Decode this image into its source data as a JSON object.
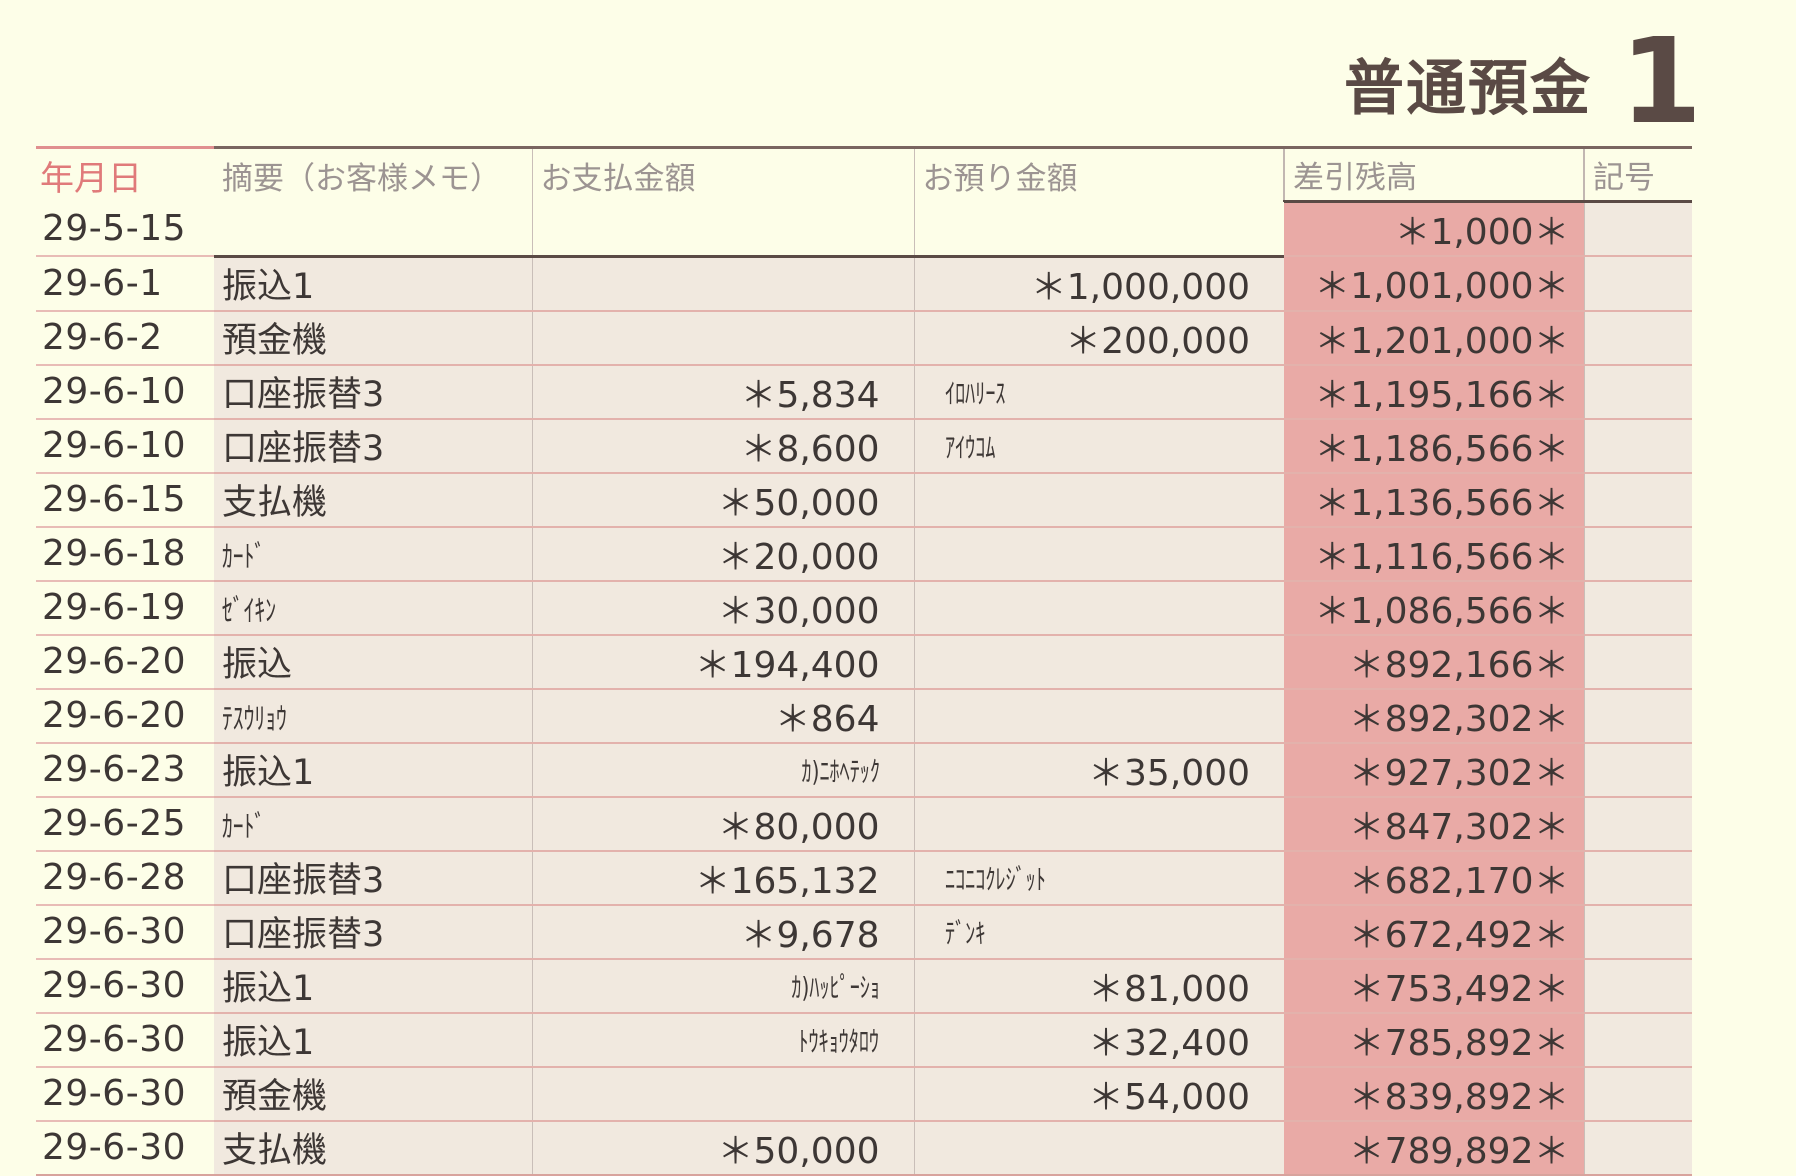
{
  "title": "普通預金",
  "page_number": "1",
  "headers": {
    "date": "年月日",
    "memo": "摘要（お客様メモ）",
    "payment": "お支払金額",
    "deposit": "お預り金額",
    "balance": "差引残高",
    "mark": "記号"
  },
  "rows": [
    {
      "date": "29-5-15",
      "memo": "",
      "payment": "",
      "payment_counterparty": "",
      "deposit": "",
      "deposit_counterparty": "",
      "balance": "＊1,000＊"
    },
    {
      "date": "29-6-1",
      "memo": "振込1",
      "payment": "",
      "payment_counterparty": "",
      "deposit": "＊1,000,000",
      "deposit_counterparty": "",
      "balance": "＊1,001,000＊"
    },
    {
      "date": "29-6-2",
      "memo": "預金機",
      "payment": "",
      "payment_counterparty": "",
      "deposit": "＊200,000",
      "deposit_counterparty": "",
      "balance": "＊1,201,000＊"
    },
    {
      "date": "29-6-10",
      "memo": "口座振替3",
      "payment": "＊5,834",
      "payment_counterparty": "",
      "deposit": "",
      "deposit_counterparty": "ｲﾛﾊﾘｰｽ",
      "balance": "＊1,195,166＊"
    },
    {
      "date": "29-6-10",
      "memo": "口座振替3",
      "payment": "＊8,600",
      "payment_counterparty": "",
      "deposit": "",
      "deposit_counterparty": "ｱｲｳｺﾑ",
      "balance": "＊1,186,566＊"
    },
    {
      "date": "29-6-15",
      "memo": "支払機",
      "payment": "＊50,000",
      "payment_counterparty": "",
      "deposit": "",
      "deposit_counterparty": "",
      "balance": "＊1,136,566＊"
    },
    {
      "date": "29-6-18",
      "memo": "ｶｰﾄﾞ",
      "payment": "＊20,000",
      "payment_counterparty": "",
      "deposit": "",
      "deposit_counterparty": "",
      "balance": "＊1,116,566＊"
    },
    {
      "date": "29-6-19",
      "memo": "ｾﾞｲｷﾝ",
      "payment": "＊30,000",
      "payment_counterparty": "",
      "deposit": "",
      "deposit_counterparty": "",
      "balance": "＊1,086,566＊"
    },
    {
      "date": "29-6-20",
      "memo": "振込",
      "payment": "＊194,400",
      "payment_counterparty": "",
      "deposit": "",
      "deposit_counterparty": "",
      "balance": "＊892,166＊"
    },
    {
      "date": "29-6-20",
      "memo": "ﾃｽｳﾘｮｳ",
      "payment": "＊864",
      "payment_counterparty": "",
      "deposit": "",
      "deposit_counterparty": "",
      "balance": "＊892,302＊"
    },
    {
      "date": "29-6-23",
      "memo": "振込1",
      "payment": "",
      "payment_counterparty": "ｶ)ﾆﾎﾍﾃｯｸ",
      "deposit": "＊35,000",
      "deposit_counterparty": "",
      "balance": "＊927,302＊"
    },
    {
      "date": "29-6-25",
      "memo": "ｶｰﾄﾞ",
      "payment": "＊80,000",
      "payment_counterparty": "",
      "deposit": "",
      "deposit_counterparty": "",
      "balance": "＊847,302＊"
    },
    {
      "date": "29-6-28",
      "memo": "口座振替3",
      "payment": "＊165,132",
      "payment_counterparty": "",
      "deposit": "",
      "deposit_counterparty": "ﾆｺﾆｺｸﾚｼﾞｯﾄ",
      "balance": "＊682,170＊"
    },
    {
      "date": "29-6-30",
      "memo": "口座振替3",
      "payment": "＊9,678",
      "payment_counterparty": "",
      "deposit": "",
      "deposit_counterparty": "ﾃﾞﾝｷ",
      "balance": "＊672,492＊"
    },
    {
      "date": "29-6-30",
      "memo": "振込1",
      "payment": "",
      "payment_counterparty": "ｶ)ﾊｯﾋﾟｰｼｮ",
      "deposit": "＊81,000",
      "deposit_counterparty": "",
      "balance": "＊753,492＊"
    },
    {
      "date": "29-6-30",
      "memo": "振込1",
      "payment": "",
      "payment_counterparty": "ﾄｳｷｮｳﾀﾛｳ",
      "deposit": "＊32,400",
      "deposit_counterparty": "",
      "balance": "＊785,892＊"
    },
    {
      "date": "29-6-30",
      "memo": "預金機",
      "payment": "",
      "payment_counterparty": "",
      "deposit": "＊54,000",
      "deposit_counterparty": "",
      "balance": "＊839,892＊"
    },
    {
      "date": "29-6-30",
      "memo": "支払機",
      "payment": "＊50,000",
      "payment_counterparty": "",
      "deposit": "",
      "deposit_counterparty": "",
      "balance": "＊789,892＊"
    }
  ],
  "colors": {
    "page_background": "#fdfee8",
    "cell_background": "#f1e9df",
    "balance_background": "#e9aaa6",
    "row_divider": "#e3b2ac",
    "date_header": "#e07a7a",
    "title": "#5a4a45"
  }
}
